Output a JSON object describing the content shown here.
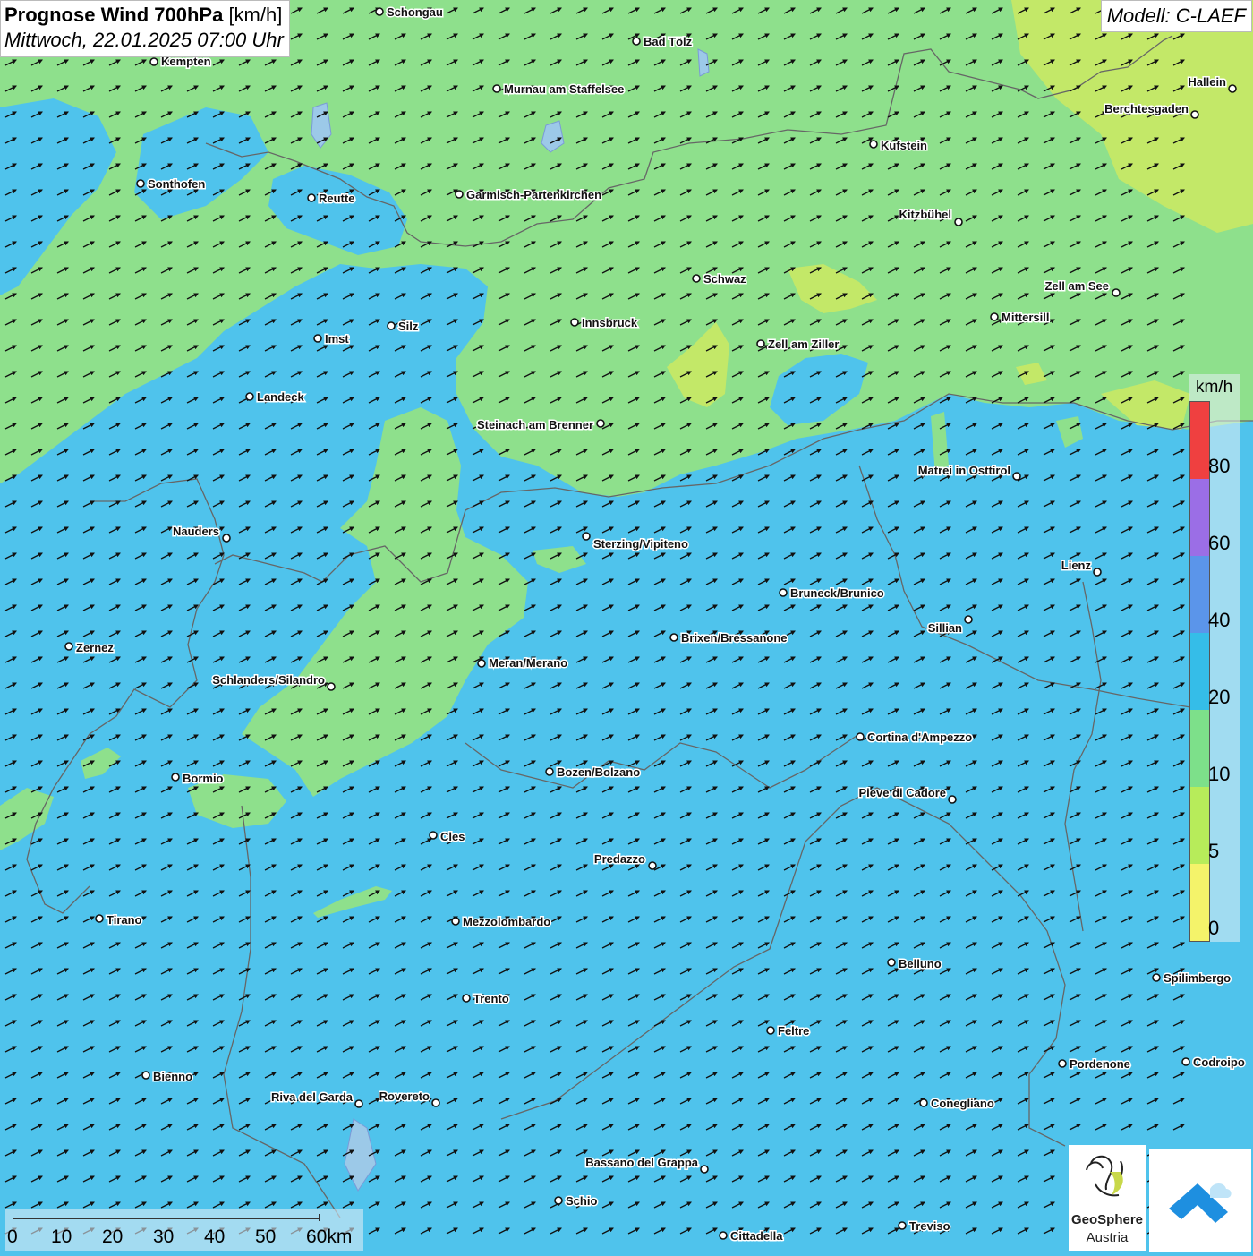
{
  "title": {
    "main": "Prognose Wind 700hPa",
    "unit": "[km/h]",
    "datetime": "Mittwoch, 22.01.2025 07:00 Uhr"
  },
  "model": "Modell: C-LAEF",
  "legend": {
    "unit": "km/h",
    "ticks": [
      "80",
      "60",
      "40",
      "20",
      "10",
      "5",
      "0"
    ],
    "colors": [
      "#ef4040",
      "#9b6ee6",
      "#5b95ea",
      "#35bde8",
      "#7de08a",
      "#b7ec5a",
      "#f4f36a"
    ]
  },
  "scale_bar": {
    "labels": [
      "0",
      "10",
      "20",
      "30",
      "40",
      "50",
      "60km"
    ]
  },
  "logo": {
    "line1": "GeoSphere",
    "line2": "Austria"
  },
  "wind": {
    "direction": "east-north-east",
    "arrow_icon": "wind-arrow-icon"
  },
  "cities": [
    "Schongau",
    "Kempten",
    "Bad Tölz",
    "Murnau am Staffelsee",
    "Hallein",
    "Berchtesgaden",
    "Kufstein",
    "Sonthofen",
    "Reutte",
    "Garmisch-Partenkirchen",
    "Kitzbühel",
    "Schwaz",
    "Zell am See",
    "Mittersill",
    "Innsbruck",
    "Imst",
    "Silz",
    "Zell am Ziller",
    "Landeck",
    "Steinach am Brenner",
    "Matrei in Osttirol",
    "Nauders",
    "Sterzing/Vipiteno",
    "Lienz",
    "Bruneck/Brunico",
    "Sillian",
    "Brixen/Bressanone",
    "Zernez",
    "Meran/Merano",
    "Schlanders/Silandro",
    "Cortina d'Ampezzo",
    "Bozen/Bolzano",
    "Bormio",
    "Pieve di Cadore",
    "Cles",
    "Predazzo",
    "Tirano",
    "Mezzolombardo",
    "Belluno",
    "Spilimbergo",
    "Trento",
    "Feltre",
    "Bienno",
    "Pordenone",
    "Codroipo",
    "Riva del Garda",
    "Rovereto",
    "Conegliano",
    "Bassano del Grappa",
    "Schio",
    "Treviso",
    "Cittadella"
  ]
}
